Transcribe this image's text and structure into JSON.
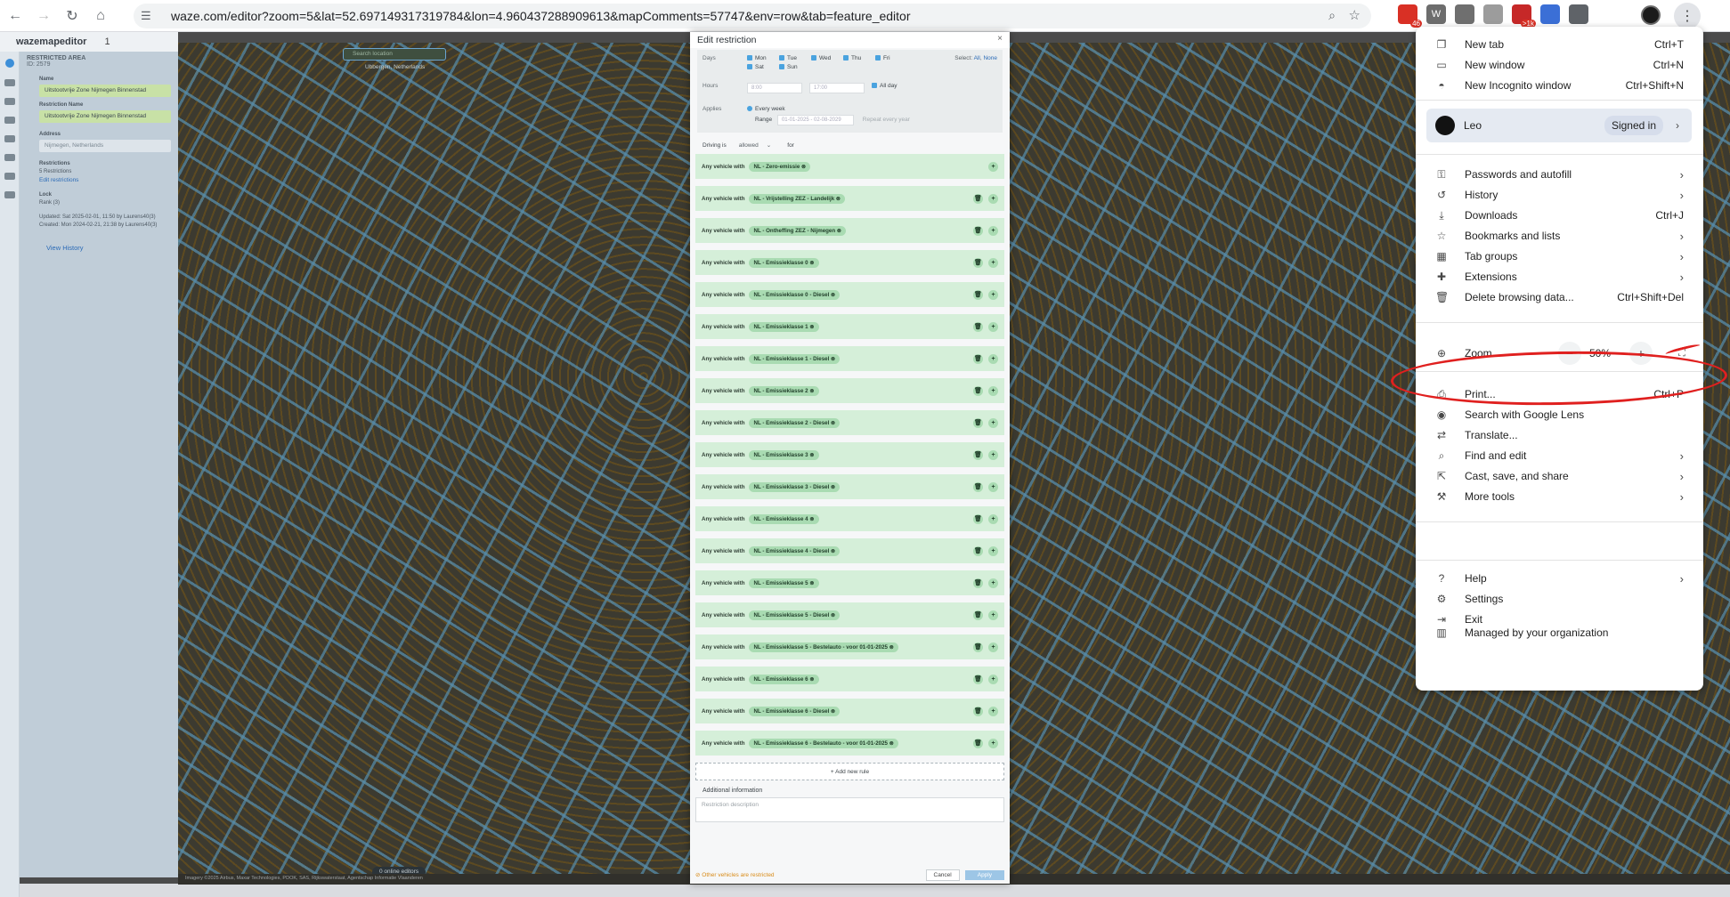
{
  "browser": {
    "url": "waze.com/editor?zoom=5&lat=52.697149317319784&lon=4.960437288909613&mapComments=57747&env=row&tab=feature_editor",
    "extensions": [
      {
        "icon": "ext-red-square",
        "badge": "46",
        "color": "#d93025"
      },
      {
        "icon": "ext-w",
        "label": "W",
        "color": "#6d6d6d"
      },
      {
        "icon": "ext-grey-square",
        "color": "#6f6f6f"
      },
      {
        "icon": "ext-face",
        "color": "#9c9c9c"
      },
      {
        "icon": "ext-calendar",
        "badge": ">1k",
        "color": "#c62828"
      },
      {
        "icon": "ext-pen",
        "color": "#3b6fd6"
      },
      {
        "icon": "puzzle-icon",
        "color": "#5f6368"
      }
    ]
  },
  "wme": {
    "logo": "wazemapeditor",
    "header_counter": "1",
    "search_placeholder": "Search location",
    "location": "Ubbergen, Netherlands",
    "editors": "0 online editors",
    "footer": "Imagery ©2025 Airbus, Maxar Technologies, PDOK, SAS, Rijkswaterstaat, Agentschap Informatie Vlaanderen"
  },
  "panel": {
    "type_label": "RESTRICTED AREA",
    "type_id": "ID: 2579",
    "name_label": "Name",
    "name_value": "Uitstootvrije Zone Nijmegen Binnenstad",
    "restriction_name_label": "Restriction Name",
    "restriction_name_value": "Uitstootvrije Zone Nijmegen Binnenstad",
    "address_label": "Address",
    "address_value": "Nijmegen, Netherlands",
    "restrictions_label": "Restrictions",
    "restrictions_count": "5 Restrictions",
    "edit_link": "Edit restrictions",
    "lock_label": "Lock",
    "lock_value": "Rank (3)",
    "updated": "Updated: Sat 2025-02-01, 11:50 by Laurens40(3)",
    "created": "Created: Mon 2024-02-21, 21:38 by Laurens40(3)",
    "view_history": "View History"
  },
  "modal": {
    "title": "Edit restriction",
    "days_label": "Days",
    "days": [
      "Mon",
      "Tue",
      "Wed",
      "Thu",
      "Fri",
      "Sat",
      "Sun"
    ],
    "select_label": "Select:",
    "select_all": "All",
    "select_none": "None",
    "hours_label": "Hours",
    "hour_from": "8:00",
    "hour_to": "17:00",
    "all_day": "All day",
    "applies_label": "Applies",
    "every_week": "Every week",
    "range_label": "Range",
    "range_value": "01-01-2025 - 02-08-2029",
    "repeat": "Repeat every year",
    "driving_is": "Driving is",
    "driving_value": "allowed",
    "for": "for",
    "rule_prefix": "Any vehicle with",
    "rules": [
      "NL - Zero-emissie",
      "NL - Vrijstelling ZEZ - Landelijk",
      "NL - Ontheffing ZEZ - Nijmegen",
      "NL - Emissieklasse 0",
      "NL - Emissieklasse 0 - Diesel",
      "NL - Emissieklasse 1",
      "NL - Emissieklasse 1 - Diesel",
      "NL - Emissieklasse 2",
      "NL - Emissieklasse 2 - Diesel",
      "NL - Emissieklasse 3",
      "NL - Emissieklasse 3 - Diesel",
      "NL - Emissieklasse 4",
      "NL - Emissieklasse 4 - Diesel",
      "NL - Emissieklasse 5",
      "NL - Emissieklasse 5 - Diesel",
      "NL - Emissieklasse 5 - Bestelauto - voor 01-01-2025",
      "NL - Emissieklasse 6",
      "NL - Emissieklasse 6 - Diesel",
      "NL - Emissieklasse 6 - Bestelauto - voor 01-01-2025"
    ],
    "add_rule": "+ Add new rule",
    "additional_info": "Additional information",
    "description_placeholder": "Restriction description",
    "warning": "Other vehicles are restricted",
    "cancel": "Cancel",
    "apply": "Apply"
  },
  "menu": {
    "items_top": [
      {
        "icon": "new-tab-icon",
        "glyph": "❐",
        "label": "New tab",
        "shortcut": "Ctrl+T"
      },
      {
        "icon": "new-window-icon",
        "glyph": "▭",
        "label": "New window",
        "shortcut": "Ctrl+N"
      },
      {
        "icon": "incognito-icon",
        "glyph": "◓",
        "label": "New Incognito window",
        "shortcut": "Ctrl+Shift+N"
      }
    ],
    "profile_name": "Leo",
    "profile_status": "Signed in",
    "items_mid": [
      {
        "icon": "key-icon",
        "glyph": "⚿",
        "label": "Passwords and autofill",
        "arrow": true
      },
      {
        "icon": "history-icon",
        "glyph": "↺",
        "label": "History",
        "arrow": true
      },
      {
        "icon": "download-icon",
        "glyph": "⤓",
        "label": "Downloads",
        "shortcut": "Ctrl+J"
      },
      {
        "icon": "star-icon",
        "glyph": "☆",
        "label": "Bookmarks and lists",
        "arrow": true
      },
      {
        "icon": "tab-groups-icon",
        "glyph": "▦",
        "label": "Tab groups",
        "arrow": true
      },
      {
        "icon": "extensions-icon",
        "glyph": "✚",
        "label": "Extensions",
        "arrow": true
      },
      {
        "icon": "trash-icon",
        "glyph": "🗑",
        "label": "Delete browsing data...",
        "shortcut": "Ctrl+Shift+Del"
      }
    ],
    "zoom_label": "Zoom",
    "zoom_value": "50%",
    "zoom_minus": "−",
    "zoom_plus": "+",
    "items_tools": [
      {
        "icon": "print-icon",
        "glyph": "⎙",
        "label": "Print...",
        "shortcut": "Ctrl+P"
      },
      {
        "icon": "lens-icon",
        "glyph": "◉",
        "label": "Search with Google Lens"
      },
      {
        "icon": "translate-icon",
        "glyph": "⇄",
        "label": "Translate..."
      },
      {
        "icon": "find-icon",
        "glyph": "⌕",
        "label": "Find and edit",
        "arrow": true
      },
      {
        "icon": "cast-icon",
        "glyph": "⇱",
        "label": "Cast, save, and share",
        "arrow": true
      },
      {
        "icon": "toolbox-icon",
        "glyph": "⚒",
        "label": "More tools",
        "arrow": true
      }
    ],
    "items_bottom": [
      {
        "icon": "help-icon",
        "glyph": "?",
        "label": "Help",
        "arrow": true
      },
      {
        "icon": "settings-icon",
        "glyph": "⚙",
        "label": "Settings"
      },
      {
        "icon": "exit-icon",
        "glyph": "⇥",
        "label": "Exit"
      }
    ],
    "managed": "Managed by your organization"
  },
  "annotation_color": "#e0201f"
}
